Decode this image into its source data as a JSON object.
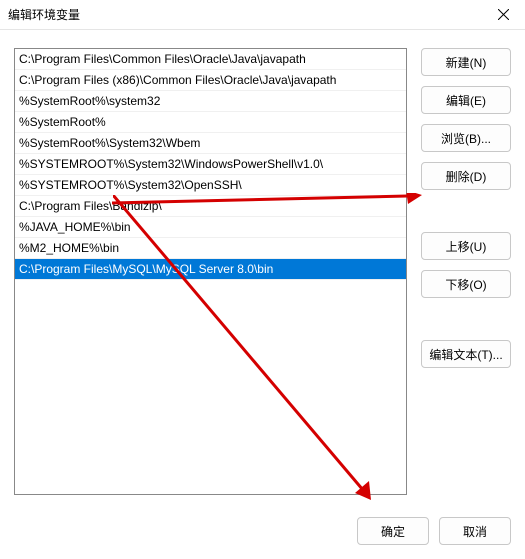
{
  "window": {
    "title": "编辑环境变量"
  },
  "path_list": {
    "items": [
      "C:\\Program Files\\Common Files\\Oracle\\Java\\javapath",
      "C:\\Program Files (x86)\\Common Files\\Oracle\\Java\\javapath",
      "%SystemRoot%\\system32",
      "%SystemRoot%",
      "%SystemRoot%\\System32\\Wbem",
      "%SYSTEMROOT%\\System32\\WindowsPowerShell\\v1.0\\",
      "%SYSTEMROOT%\\System32\\OpenSSH\\",
      "C:\\Program Files\\Bandizip\\",
      "%JAVA_HOME%\\bin",
      "%M2_HOME%\\bin",
      "C:\\Program Files\\MySQL\\MySQL Server 8.0\\bin"
    ],
    "selected_index": 10
  },
  "buttons": {
    "new": "新建(N)",
    "edit": "编辑(E)",
    "browse": "浏览(B)...",
    "delete": "删除(D)",
    "move_up": "上移(U)",
    "move_down": "下移(O)",
    "edit_text": "编辑文本(T)...",
    "ok": "确定",
    "cancel": "取消"
  },
  "annotation_color": "#d40000"
}
